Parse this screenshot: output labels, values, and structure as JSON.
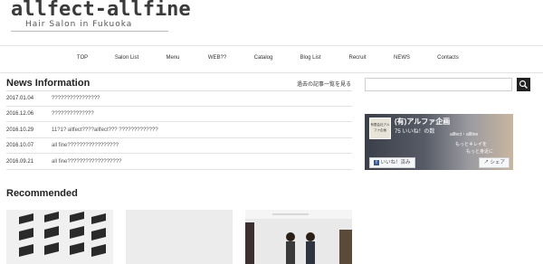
{
  "header": {
    "logo_main": "allfect-allfine",
    "logo_sub": "Hair Salon in Fukuoka"
  },
  "nav": {
    "items": [
      {
        "label": "TOP"
      },
      {
        "label": "Salon List"
      },
      {
        "label": "Menu"
      },
      {
        "label": "WEB??"
      },
      {
        "label": "Catalog"
      },
      {
        "label": "Blog List"
      },
      {
        "label": "Recruit"
      },
      {
        "label": "NEWS"
      },
      {
        "label": "Contacts"
      }
    ]
  },
  "news": {
    "title": "News Information",
    "more_link": "過去の記事一覧を見る",
    "rows": [
      {
        "date": "2017.01.04",
        "text": "????????????????"
      },
      {
        "date": "2016.12.06",
        "text": "??????????????"
      },
      {
        "date": "2016.10.29",
        "text": "11?1? allfect????allfect??? ?????????????"
      },
      {
        "date": "2016.10.07",
        "text": "all fine?????????????????"
      },
      {
        "date": "2016.09.21",
        "text": "all fine??????????????????"
      }
    ]
  },
  "recommended": {
    "title": "Recommended"
  },
  "facebook": {
    "page_name": "(有)アルファ企画",
    "likes": "75 いいね！の数",
    "thumb_text": "有限会社アルファ企画",
    "tag1": "allfect・allfine",
    "tag2": "もっとキレイを",
    "tag3": "もっと身近に",
    "like_button": "いいね！済み",
    "share_button": "シェア"
  }
}
